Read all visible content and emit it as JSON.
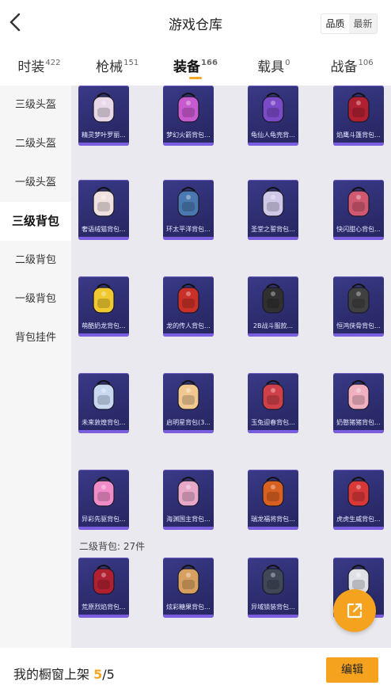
{
  "header": {
    "back_icon": "chevron-left-icon",
    "title": "游戏仓库",
    "sort": {
      "quality": "品质",
      "latest": "最新",
      "selected": "quality"
    }
  },
  "tabs": [
    {
      "label": "时装",
      "count": "422"
    },
    {
      "label": "枪械",
      "count": "151"
    },
    {
      "label": "装备",
      "count": "166",
      "active": true
    },
    {
      "label": "载具",
      "count": "0"
    },
    {
      "label": "战备",
      "count": "106"
    }
  ],
  "sidebar": [
    {
      "label": "三级头盔"
    },
    {
      "label": "二级头盔"
    },
    {
      "label": "一级头盔"
    },
    {
      "label": "三级背包",
      "active": true
    },
    {
      "label": "二级背包"
    },
    {
      "label": "一级背包"
    },
    {
      "label": "背包挂件"
    }
  ],
  "items": [
    {
      "name": "精灵梦叶罗丽...",
      "color": "#e8d8e8"
    },
    {
      "name": "梦幻火箭背包...",
      "color": "#c85ad0"
    },
    {
      "name": "龟仙人龟壳背...",
      "color": "#7a4ac8"
    },
    {
      "name": "焰鹰斗篷背包...",
      "color": "#b02030"
    },
    {
      "name": "奢语绒猫背包...",
      "color": "#f0e0e0"
    },
    {
      "name": "环太平洋背包...",
      "color": "#4a78b0"
    },
    {
      "name": "圣堂之誓背包...",
      "color": "#d0c8e8"
    },
    {
      "name": "快闪甜心背包...",
      "color": "#d05870"
    },
    {
      "name": "萌酷奶龙背包...",
      "color": "#f0c830"
    },
    {
      "name": "龙的传人背包...",
      "color": "#c83028"
    },
    {
      "name": "2B战斗服款...",
      "color": "#303030"
    },
    {
      "name": "恒鸿侠骨背包...",
      "color": "#404040"
    },
    {
      "name": "未来敦煌背包...",
      "color": "#c8d8f0"
    },
    {
      "name": "启明星背包(3...",
      "color": "#f0c890"
    },
    {
      "name": "玉兔迎春背包...",
      "color": "#d04048"
    },
    {
      "name": "奶憨猪猪背包...",
      "color": "#f0b0c0"
    },
    {
      "name": "异彩先驱背包...",
      "color": "#f08cc8"
    },
    {
      "name": "海渊国主背包...",
      "color": "#e8a8c8"
    },
    {
      "name": "瑞龙福将背包...",
      "color": "#d86020"
    },
    {
      "name": "虎虎生威背包...",
      "color": "#d83838"
    }
  ],
  "section2": {
    "label": "二级背包: 27件",
    "items": [
      {
        "name": "荒原烈焰背包...",
        "color": "#b02030"
      },
      {
        "name": "炫彩糖果背包...",
        "color": "#d8a060"
      },
      {
        "name": "异域锁装背包...",
        "color": "#404858"
      },
      {
        "name": "",
        "color": "#e0e0e8"
      }
    ]
  },
  "fab": {
    "icon": "share-external-icon"
  },
  "footer": {
    "label": "我的橱窗上架",
    "current": "5",
    "total": "/5",
    "edit_label": "编辑"
  },
  "colors": {
    "accent": "#f5a31f",
    "card": "#2d2d70",
    "card_bar": "#7b5de0"
  }
}
